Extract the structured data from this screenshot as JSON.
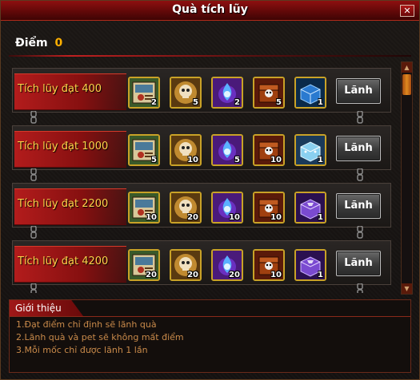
{
  "window": {
    "title": "Quà tích lũy",
    "close_label": "✕"
  },
  "points": {
    "label": "Điểm",
    "value": "0"
  },
  "rows": [
    {
      "label": "Tích lũy đạt 400",
      "rewards": [
        {
          "icon": "scroll-card",
          "qty": "2"
        },
        {
          "icon": "skull-orb",
          "qty": "5"
        },
        {
          "icon": "blue-flame-orb",
          "qty": "2"
        },
        {
          "icon": "skull-chest",
          "qty": "5"
        },
        {
          "icon": "blue-crystal-box",
          "qty": "1"
        }
      ],
      "button": "Lãnh"
    },
    {
      "label": "Tích lũy đạt 1000",
      "rewards": [
        {
          "icon": "scroll-card",
          "qty": "5"
        },
        {
          "icon": "skull-orb",
          "qty": "10"
        },
        {
          "icon": "blue-flame-orb",
          "qty": "5"
        },
        {
          "icon": "skull-chest",
          "qty": "10"
        },
        {
          "icon": "cyan-box",
          "qty": "1"
        }
      ],
      "button": "Lãnh"
    },
    {
      "label": "Tích lũy đạt 2200",
      "rewards": [
        {
          "icon": "scroll-card",
          "qty": "10"
        },
        {
          "icon": "skull-orb",
          "qty": "20"
        },
        {
          "icon": "blue-flame-orb",
          "qty": "10"
        },
        {
          "icon": "skull-chest",
          "qty": "10"
        },
        {
          "icon": "purple-box",
          "qty": "1"
        }
      ],
      "button": "Lãnh"
    },
    {
      "label": "Tích lũy đạt 4200",
      "rewards": [
        {
          "icon": "scroll-card",
          "qty": "20"
        },
        {
          "icon": "skull-orb",
          "qty": "20"
        },
        {
          "icon": "blue-flame-orb",
          "qty": "20"
        },
        {
          "icon": "skull-chest",
          "qty": "10"
        },
        {
          "icon": "purple-box",
          "qty": "1"
        }
      ],
      "button": "Lãnh"
    }
  ],
  "intro": {
    "title": "Giới thiệu",
    "lines": [
      "1.Đạt điểm chỉ định sẽ lãnh quà",
      "2.Lãnh quà và pet sẽ không mất điểm",
      "3.Mỗi mốc chỉ được lãnh 1 lần"
    ]
  },
  "colors": {
    "accent_red": "#a01818",
    "label_gold": "#ffd24a",
    "intro_text": "#c98a4a",
    "points_value": "#ffb000"
  }
}
